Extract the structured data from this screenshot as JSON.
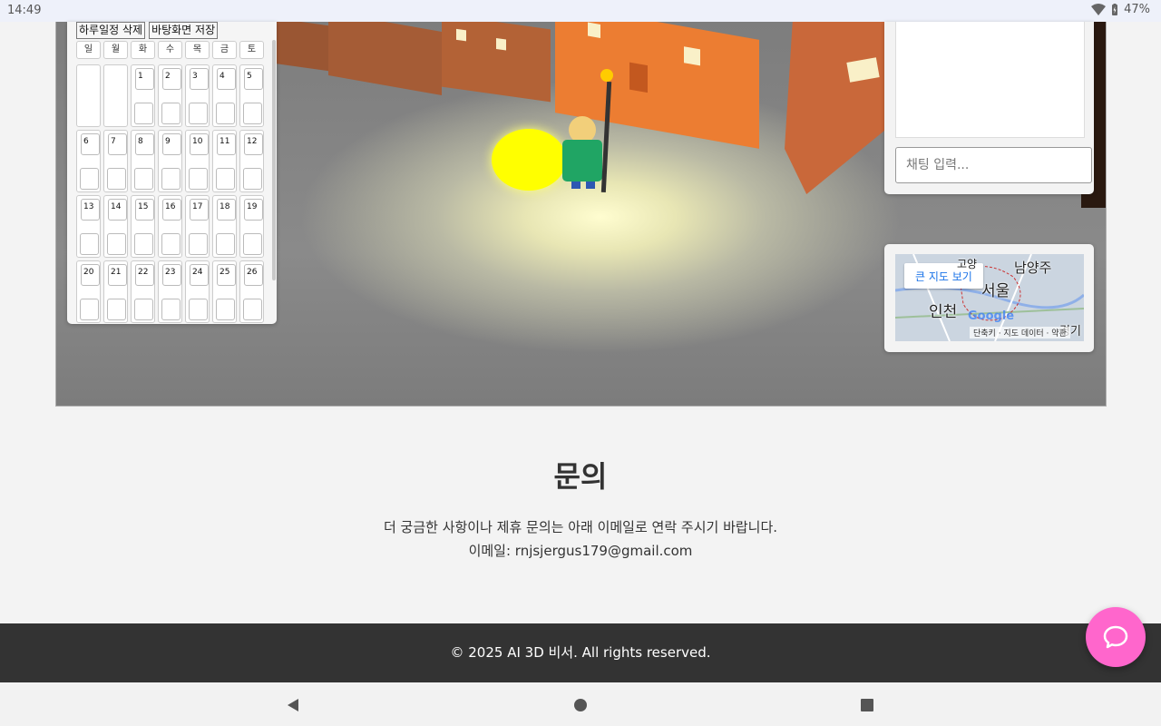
{
  "status_bar": {
    "time": "14:49",
    "battery": "47%"
  },
  "calendar": {
    "buttons": [
      "하루일정 삭제",
      "바탕화면 저장"
    ],
    "weekdays": [
      "일",
      "월",
      "화",
      "수",
      "목",
      "금",
      "토"
    ],
    "weeks": [
      [
        "",
        "",
        "1",
        "2",
        "3",
        "4",
        "5"
      ],
      [
        "6",
        "7",
        "8",
        "9",
        "10",
        "11",
        "12"
      ],
      [
        "13",
        "14",
        "15",
        "16",
        "17",
        "18",
        "19"
      ],
      [
        "20",
        "21",
        "22",
        "23",
        "24",
        "25",
        "26"
      ]
    ]
  },
  "chat": {
    "placeholder": "채팅 입력..."
  },
  "map": {
    "button": "큰 지도 보기",
    "labels": {
      "seoul": "서울",
      "incheon": "인천",
      "namyangju": "남양주",
      "gyeonggi": "경기",
      "top": "고양"
    },
    "logo": "Google",
    "footer": "단축키 · 지도 데이터 · 약관"
  },
  "contact": {
    "title": "문의",
    "line1": "더 궁금한 사항이나 제휴 문의는 아래 이메일로 연락 주시기 바랍니다.",
    "line2": "이메일: rnjsjergus179@gmail.com"
  },
  "footer": {
    "copyright": "© 2025 AI 3D 비서. All rights reserved."
  },
  "colors": {
    "fab": "#ff66cc",
    "footer_bg": "#333333",
    "map_link": "#1a73e8"
  }
}
